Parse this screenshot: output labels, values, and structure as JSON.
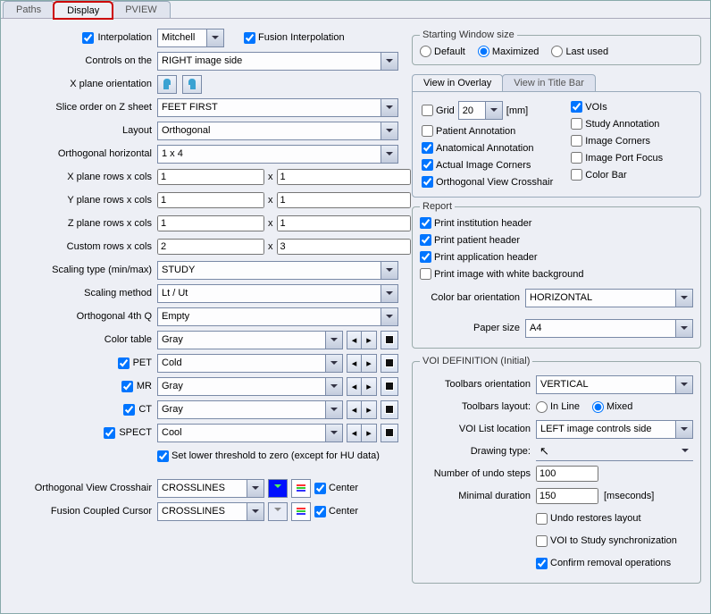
{
  "tabs": {
    "paths": "Paths",
    "display": "Display",
    "pview": "PVIEW"
  },
  "left": {
    "interpolation": "Interpolation",
    "interpolation_method": "Mitchell",
    "fusion_interpolation": "Fusion Interpolation",
    "controls_on_the": "Controls on the",
    "controls_on_the_val": "RIGHT image side",
    "x_plane_orientation": "X plane orientation",
    "slice_order": "Slice order on Z sheet",
    "slice_order_val": "FEET FIRST",
    "layout": "Layout",
    "layout_val": "Orthogonal",
    "ortho_h": "Orthogonal horizontal",
    "ortho_h_val": "1 x 4",
    "x_plane_rc": "X plane rows x cols",
    "x_r": "1",
    "x_c": "1",
    "y_plane_rc": "Y plane rows x cols",
    "y_r": "1",
    "y_c": "1",
    "z_plane_rc": "Z plane rows x cols",
    "z_r": "1",
    "z_c": "1",
    "custom_rc": "Custom rows x cols",
    "c_r": "2",
    "c_c": "3",
    "x_sep": "x",
    "scaling_type": "Scaling type (min/max)",
    "scaling_type_val": "STUDY",
    "scaling_method": "Scaling method",
    "scaling_method_val": "Lt / Ut",
    "ortho_4th": "Orthogonal 4th Q",
    "ortho_4th_val": "Empty",
    "color_table": "Color table",
    "color_table_val": "Gray",
    "pet": "PET",
    "pet_val": "Cold",
    "mr": "MR",
    "mr_val": "Gray",
    "ct": "CT",
    "ct_val": "Gray",
    "spect": "SPECT",
    "spect_val": "Cool",
    "set_lower": "Set lower threshold to zero (except for HU data)",
    "ortho_crosshair": "Orthogonal View Crosshair",
    "ortho_crosshair_val": "CROSSLINES",
    "center": "Center",
    "fusion_cursor": "Fusion Coupled Cursor",
    "fusion_cursor_val": "CROSSLINES"
  },
  "right": {
    "starting_win_size": "Starting Window size",
    "default": "Default",
    "maximized": "Maximized",
    "last_used": "Last used",
    "view_overlay": "View in Overlay",
    "view_titlebar": "View in Title Bar",
    "grid": "Grid",
    "grid_val": "20",
    "mm": "[mm]",
    "vois": "VOIs",
    "patient_ann": "Patient Annotation",
    "study_ann": "Study Annotation",
    "anat_ann": "Anatomical Annotation",
    "img_corners": "Image Corners",
    "actual_corners": "Actual Image Corners",
    "port_focus": "Image Port Focus",
    "ortho_crosshair": "Orthogonal View Crosshair",
    "color_bar": "Color Bar",
    "report": "Report",
    "print_inst": "Print institution header",
    "print_pat": "Print patient header",
    "print_app": "Print application header",
    "print_bg": "Print image with white background",
    "cb_orient": "Color bar orientation",
    "cb_orient_val": "HORIZONTAL",
    "paper": "Paper size",
    "paper_val": "A4",
    "voi_def": "VOI DEFINITION (Initial)",
    "tb_orient": "Toolbars orientation",
    "tb_orient_val": "VERTICAL",
    "tb_layout": "Toolbars layout:",
    "inline": "In Line",
    "mixed": "Mixed",
    "voi_list": "VOI List location",
    "voi_list_val": "LEFT image controls side",
    "drawing_type": "Drawing type:",
    "undo_steps": "Number of undo steps",
    "undo_steps_val": "100",
    "min_dur": "Minimal duration",
    "min_dur_val": "150",
    "mseconds": "[mseconds]",
    "undo_restore": "Undo restores layout",
    "voi_sync": "VOI to Study synchronization",
    "confirm_remove": "Confirm removal operations"
  }
}
